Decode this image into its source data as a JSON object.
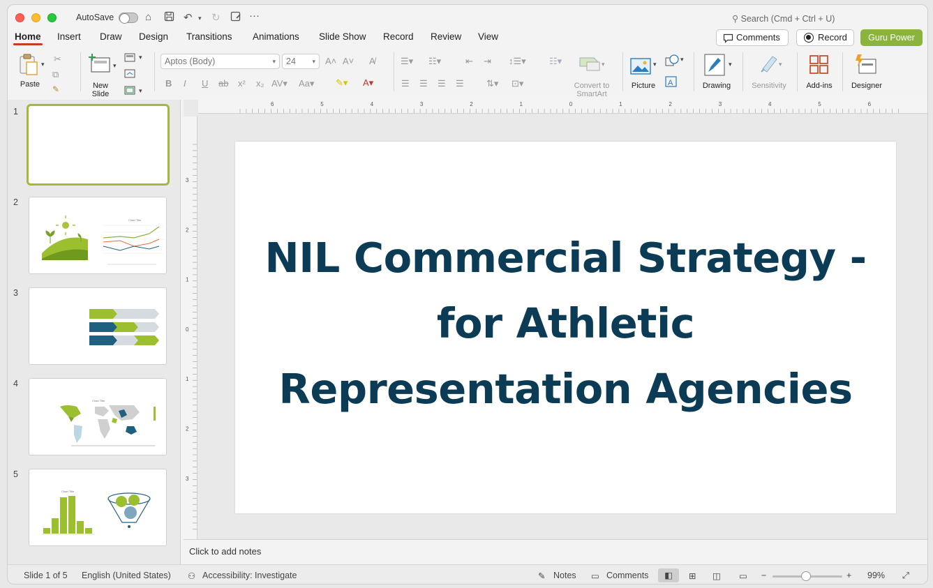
{
  "titlebar": {
    "autosave_label": "AutoSave",
    "search_placeholder": "Search (Cmd + Ctrl + U)"
  },
  "tabs": [
    "Home",
    "Insert",
    "Draw",
    "Design",
    "Transitions",
    "Animations",
    "Slide Show",
    "Record",
    "Review",
    "View"
  ],
  "active_tab": "Home",
  "header_buttons": {
    "comments": "Comments",
    "record": "Record",
    "guru": "Guru Power"
  },
  "toolbar": {
    "paste": "Paste",
    "new_slide": "New Slide",
    "font_name": "Aptos (Body)",
    "font_size": "24",
    "convert_smartart": "Convert to SmartArt",
    "picture": "Picture",
    "drawing": "Drawing",
    "sensitivity": "Sensitivity",
    "addins": "Add-ins",
    "designer": "Designer"
  },
  "ruler": {
    "horizontal_ticks": [
      "6",
      "5",
      "4",
      "3",
      "2",
      "1",
      "0",
      "1",
      "2",
      "3",
      "4",
      "5",
      "6"
    ],
    "vertical_ticks": [
      "3",
      "2",
      "1",
      "0",
      "1",
      "2",
      "3"
    ]
  },
  "thumbnails": [
    {
      "num": "1"
    },
    {
      "num": "2",
      "chart_title": "Chart Title"
    },
    {
      "num": "3"
    },
    {
      "num": "4",
      "chart_title": "Chart Title"
    },
    {
      "num": "5",
      "chart_title": "Chart Title"
    }
  ],
  "slide": {
    "title": "NIL Commercial Strategy - for Athletic Representation Agencies"
  },
  "notes": {
    "placeholder": "Click to add notes"
  },
  "status": {
    "slide_count": "Slide 1 of 5",
    "language": "English (United States)",
    "accessibility": "Accessibility: Investigate",
    "notes": "Notes",
    "comments": "Comments",
    "zoom": "99%"
  },
  "colors": {
    "accent_green": "#8ab43c",
    "title_navy": "#0b3b55",
    "tab_underline": "#c43e1c"
  }
}
